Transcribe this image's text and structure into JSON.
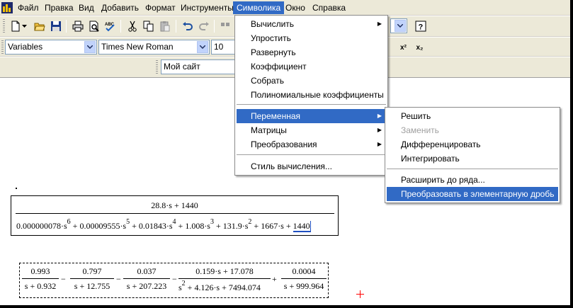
{
  "menubar": {
    "items": [
      "Файл",
      "Правка",
      "Вид",
      "Добавить",
      "Формат",
      "Инструменты",
      "Символика",
      "Окно",
      "Справка"
    ],
    "active": "Символика"
  },
  "toolbar2": {
    "style_value": "Variables",
    "font_value": "Times New Roman",
    "size_value": "10",
    "superscript_label": "x²",
    "subscript_label": "x₂"
  },
  "toolbar3": {
    "resource_value": "Мой сайт"
  },
  "symbolics_menu": {
    "items": [
      {
        "label": "Вычислить",
        "submenu": true
      },
      {
        "label": "Упростить"
      },
      {
        "label": "Развернуть"
      },
      {
        "label": "Коэффициент"
      },
      {
        "label": "Собрать"
      },
      {
        "label": "Полиномиальные коэффициенты"
      },
      {
        "label": "Переменная",
        "submenu": true,
        "selected": true
      },
      {
        "label": "Матрицы",
        "submenu": true
      },
      {
        "label": "Преобразования",
        "submenu": true
      },
      {
        "label": "Стиль вычисления..."
      }
    ]
  },
  "variable_submenu": {
    "items": [
      {
        "label": "Решить"
      },
      {
        "label": "Заменить",
        "disabled": true
      },
      {
        "label": "Дифференцировать"
      },
      {
        "label": "Интегрировать"
      },
      {
        "label": "Расширить до ряда..."
      },
      {
        "label": "Преобразовать в элементарную дробь",
        "selected": true
      }
    ]
  },
  "document": {
    "expr1": {
      "numerator": "28.8·s + 1440",
      "denominator": {
        "t1": "0.000000078·s",
        "e1": "6",
        "t2": " + 0.00009555·s",
        "e2": "5",
        "t3": " + 0.01843·s",
        "e3": "4",
        "t4": " + 1.008·s",
        "e4": "3",
        "t5": " + 131.9·s",
        "e5": "2",
        "t6": " + 1667·s + ",
        "t7": "1440"
      }
    },
    "expr2": {
      "fracs": [
        {
          "num": "0.993",
          "den": "s + 0.932"
        },
        {
          "num": "0.797",
          "den": "s + 12.755"
        },
        {
          "num": "0.037",
          "den": "s + 207.223"
        },
        {
          "num": "0.159·s + 17.078",
          "den_a": "s",
          "den_e": "2",
          "den_b": " + 4.126·s + 7494.074"
        },
        {
          "num": "0.0004",
          "den": "s + 999.964"
        }
      ],
      "ops": [
        "−",
        "−",
        "−",
        "+"
      ]
    }
  },
  "colors": {
    "menu_highlight": "#316ac5",
    "chrome": "#ece9d8",
    "cursor_cross": "#ff0000"
  }
}
